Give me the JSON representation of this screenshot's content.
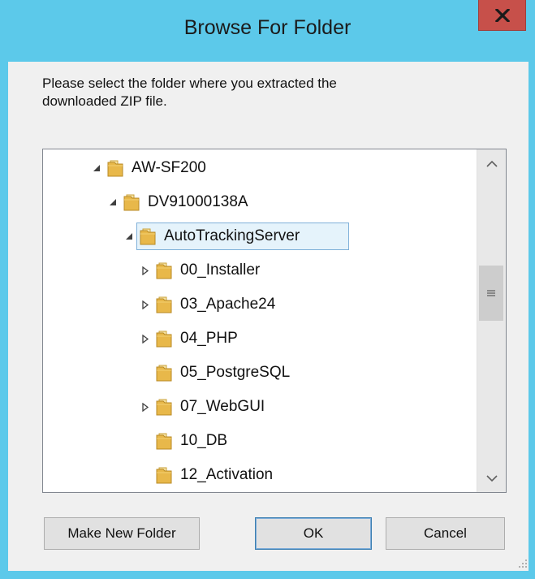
{
  "window": {
    "title": "Browse For Folder",
    "close_icon": "close-x-icon"
  },
  "instructions": "Please select the folder where you extracted the\ndownloaded ZIP file.",
  "tree": {
    "items": [
      {
        "label": "AW-SF200",
        "expander": "expanded",
        "icon": "folder-icon"
      },
      {
        "label": "DV91000138A",
        "expander": "expanded",
        "icon": "folder-icon"
      },
      {
        "label": "AutoTrackingServer",
        "expander": "expanded",
        "icon": "folder-icon",
        "selected": true
      },
      {
        "label": "00_Installer",
        "expander": "collapsed",
        "icon": "folder-icon"
      },
      {
        "label": "03_Apache24",
        "expander": "collapsed",
        "icon": "folder-icon"
      },
      {
        "label": "04_PHP",
        "expander": "collapsed",
        "icon": "folder-icon"
      },
      {
        "label": "05_PostgreSQL",
        "expander": "none",
        "icon": "folder-icon"
      },
      {
        "label": "07_WebGUI",
        "expander": "collapsed",
        "icon": "folder-icon"
      },
      {
        "label": "10_DB",
        "expander": "none",
        "icon": "folder-icon"
      },
      {
        "label": "12_Activation",
        "expander": "none",
        "icon": "folder-icon"
      }
    ],
    "scroll_position": 0.48
  },
  "buttons": {
    "make_new_folder": "Make New Folder",
    "ok": "OK",
    "cancel": "Cancel"
  },
  "colors": {
    "titlebar": "#5cc9ea",
    "close_button": "#c7504a",
    "selection": "#e5f3fb",
    "folder": "#e8b84a"
  }
}
